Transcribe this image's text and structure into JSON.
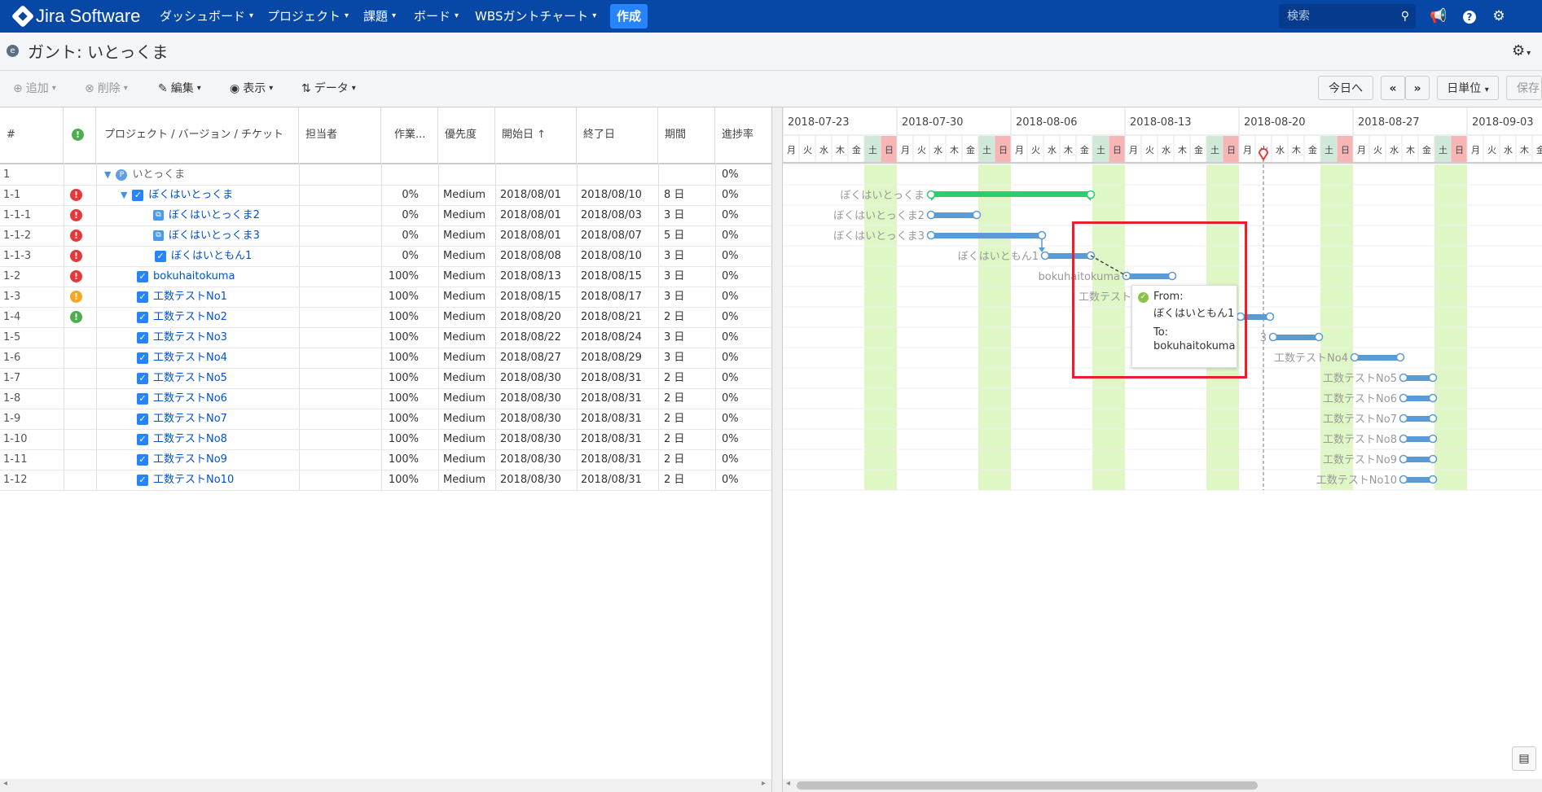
{
  "topnav": {
    "brand": "Jira Software",
    "menus": [
      "ダッシュボード",
      "プロジェクト",
      "課題",
      "ボード",
      "WBSガントチャート"
    ],
    "create": "作成",
    "search_placeholder": "検索",
    "icons": [
      "megaphone-icon",
      "help-icon",
      "settings-icon"
    ]
  },
  "page": {
    "title": "ガント: いとっくま"
  },
  "toolbar": {
    "add": "追加",
    "delete": "削除",
    "edit": "編集",
    "view": "表示",
    "data": "データ",
    "today": "今日へ",
    "prev": "«",
    "next": "»",
    "unit": "日単位",
    "save": "保存"
  },
  "grid": {
    "columns": [
      "#",
      "",
      "プロジェクト / バージョン / チケット",
      "担当者",
      "作業...",
      "優先度",
      "開始日",
      "終了日",
      "期間",
      "進捗率"
    ],
    "rows": [
      {
        "num": "1",
        "pri": "",
        "name": "いとっくま",
        "type": "project",
        "indent": 0,
        "effort": "",
        "priority": "",
        "start": "",
        "end": "",
        "dur": "",
        "prog": "0%"
      },
      {
        "num": "1-1",
        "pri": "red",
        "name": "ぼくはいとっくま",
        "type": "task-open",
        "indent": 1,
        "effort": "0%",
        "priority": "Medium",
        "start": "2018/08/01",
        "end": "2018/08/10",
        "dur": "8 日",
        "prog": "0%"
      },
      {
        "num": "1-1-1",
        "pri": "red",
        "name": "ぼくはいとっくま2",
        "type": "subtask",
        "indent": 2,
        "effort": "0%",
        "priority": "Medium",
        "start": "2018/08/01",
        "end": "2018/08/03",
        "dur": "3 日",
        "prog": "0%"
      },
      {
        "num": "1-1-2",
        "pri": "red",
        "name": "ぼくはいとっくま3",
        "type": "subtask",
        "indent": 2,
        "effort": "0%",
        "priority": "Medium",
        "start": "2018/08/01",
        "end": "2018/08/07",
        "dur": "5 日",
        "prog": "0%"
      },
      {
        "num": "1-1-3",
        "pri": "red",
        "name": "ぼくはいともん1",
        "type": "task",
        "indent": 2,
        "effort": "0%",
        "priority": "Medium",
        "start": "2018/08/08",
        "end": "2018/08/10",
        "dur": "3 日",
        "prog": "0%"
      },
      {
        "num": "1-2",
        "pri": "red",
        "name": "bokuhaitokuma",
        "type": "task",
        "indent": 1,
        "effort": "100%",
        "priority": "Medium",
        "start": "2018/08/13",
        "end": "2018/08/15",
        "dur": "3 日",
        "prog": "0%"
      },
      {
        "num": "1-3",
        "pri": "orange",
        "name": "工数テストNo1",
        "type": "task",
        "indent": 1,
        "effort": "100%",
        "priority": "Medium",
        "start": "2018/08/15",
        "end": "2018/08/17",
        "dur": "3 日",
        "prog": "0%"
      },
      {
        "num": "1-4",
        "pri": "green",
        "name": "工数テストNo2",
        "type": "task",
        "indent": 1,
        "effort": "100%",
        "priority": "Medium",
        "start": "2018/08/20",
        "end": "2018/08/21",
        "dur": "2 日",
        "prog": "0%"
      },
      {
        "num": "1-5",
        "pri": "",
        "name": "工数テストNo3",
        "type": "task",
        "indent": 1,
        "effort": "100%",
        "priority": "Medium",
        "start": "2018/08/22",
        "end": "2018/08/24",
        "dur": "3 日",
        "prog": "0%"
      },
      {
        "num": "1-6",
        "pri": "",
        "name": "工数テストNo4",
        "type": "task",
        "indent": 1,
        "effort": "100%",
        "priority": "Medium",
        "start": "2018/08/27",
        "end": "2018/08/29",
        "dur": "3 日",
        "prog": "0%"
      },
      {
        "num": "1-7",
        "pri": "",
        "name": "工数テストNo5",
        "type": "task",
        "indent": 1,
        "effort": "100%",
        "priority": "Medium",
        "start": "2018/08/30",
        "end": "2018/08/31",
        "dur": "2 日",
        "prog": "0%"
      },
      {
        "num": "1-8",
        "pri": "",
        "name": "工数テストNo6",
        "type": "task",
        "indent": 1,
        "effort": "100%",
        "priority": "Medium",
        "start": "2018/08/30",
        "end": "2018/08/31",
        "dur": "2 日",
        "prog": "0%"
      },
      {
        "num": "1-9",
        "pri": "",
        "name": "工数テストNo7",
        "type": "task",
        "indent": 1,
        "effort": "100%",
        "priority": "Medium",
        "start": "2018/08/30",
        "end": "2018/08/31",
        "dur": "2 日",
        "prog": "0%"
      },
      {
        "num": "1-10",
        "pri": "",
        "name": "工数テストNo8",
        "type": "task",
        "indent": 1,
        "effort": "100%",
        "priority": "Medium",
        "start": "2018/08/30",
        "end": "2018/08/31",
        "dur": "2 日",
        "prog": "0%"
      },
      {
        "num": "1-11",
        "pri": "",
        "name": "工数テストNo9",
        "type": "task",
        "indent": 1,
        "effort": "100%",
        "priority": "Medium",
        "start": "2018/08/30",
        "end": "2018/08/31",
        "dur": "2 日",
        "prog": "0%"
      },
      {
        "num": "1-12",
        "pri": "",
        "name": "工数テストNo10",
        "type": "task",
        "indent": 1,
        "effort": "100%",
        "priority": "Medium",
        "start": "2018/08/30",
        "end": "2018/08/31",
        "dur": "2 日",
        "prog": "0%"
      }
    ]
  },
  "gantt": {
    "weeks": [
      "2018-07-23",
      "2018-07-30",
      "2018-08-06",
      "2018-08-13",
      "2018-08-20",
      "2018-08-27",
      "2018-09-03"
    ],
    "weekdays": [
      "月",
      "火",
      "水",
      "木",
      "金",
      "土",
      "日"
    ],
    "today": "2018-08-21",
    "bar_labels": [
      "ぼくはいとっくま",
      "ぼくはいとっくま2",
      "ぼくはいとっくま3",
      "ぼくはいともん1",
      "bokuhaitokuma",
      "工数テストNo1",
      "",
      "3",
      "工数テストNo4",
      "工数テストNo5",
      "工数テストNo6",
      "工数テストNo7",
      "工数テストNo8",
      "工数テストNo9",
      "工数テストNo10"
    ]
  },
  "tooltip": {
    "from_label": "From:",
    "from_value": "ぼくはいともん1",
    "to_label": "To:",
    "to_value": "bokuhaitokuma"
  },
  "colors": {
    "nav": "#0747a6",
    "bar": "#5b9bd5",
    "summary": "#2ecc71",
    "weekend_bg": "#dff7c4",
    "sat_hdr": "#cfe8d8",
    "sun_hdr": "#f7b6b6",
    "highlight": "#e8202a"
  }
}
